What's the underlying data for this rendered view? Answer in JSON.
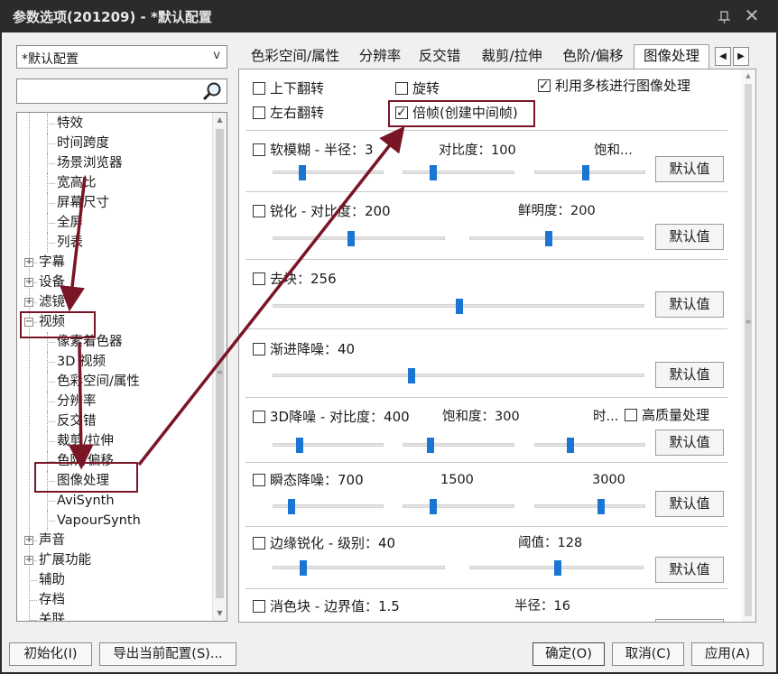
{
  "window": {
    "title": "参数选项(201209) - *默认配置"
  },
  "profile": {
    "selected": "*默认配置"
  },
  "search": {
    "placeholder": "",
    "value": ""
  },
  "tree": {
    "items": [
      {
        "label": "特效",
        "level": 2
      },
      {
        "label": "时间跨度",
        "level": 2
      },
      {
        "label": "场景浏览器",
        "level": 2
      },
      {
        "label": "宽高比",
        "level": 2
      },
      {
        "label": "屏幕尺寸",
        "level": 2
      },
      {
        "label": "全屏",
        "level": 2
      },
      {
        "label": "列表",
        "level": 2
      },
      {
        "label": "字幕",
        "level": 1,
        "expander": "+"
      },
      {
        "label": "设备",
        "level": 1,
        "expander": "+"
      },
      {
        "label": "滤镜",
        "level": 1,
        "expander": "+"
      },
      {
        "label": "视频",
        "level": 1,
        "expander": "−"
      },
      {
        "label": "像素着色器",
        "level": 2
      },
      {
        "label": "3D 视频",
        "level": 2
      },
      {
        "label": "色彩空间/属性",
        "level": 2
      },
      {
        "label": "分辨率",
        "level": 2
      },
      {
        "label": "反交错",
        "level": 2
      },
      {
        "label": "裁剪/拉伸",
        "level": 2
      },
      {
        "label": "色阶/偏移",
        "level": 2
      },
      {
        "label": "图像处理",
        "level": 2,
        "selected": true
      },
      {
        "label": "AviSynth",
        "level": 2
      },
      {
        "label": "VapourSynth",
        "level": 2
      },
      {
        "label": "声音",
        "level": 1,
        "expander": "+"
      },
      {
        "label": "扩展功能",
        "level": 1,
        "expander": "+"
      },
      {
        "label": "辅助",
        "level": 1
      },
      {
        "label": "存档",
        "level": 1
      },
      {
        "label": "关联",
        "level": 1
      }
    ]
  },
  "tabs": [
    "色彩空间/属性",
    "分辨率",
    "反交错",
    "裁剪/拉伸",
    "色阶/偏移",
    "图像处理"
  ],
  "active_tab": "图像处理",
  "options": {
    "flip_v": {
      "label": "上下翻转",
      "checked": false
    },
    "rotate": {
      "label": "旋转",
      "checked": false
    },
    "multicore": {
      "label": "利用多核进行图像处理",
      "checked": true
    },
    "flip_h": {
      "label": "左右翻转",
      "checked": false
    },
    "double_frame": {
      "label": "倍帧(创建中间帧)",
      "checked": true
    }
  },
  "groups": {
    "soft_blur": {
      "label": "软模糊 - 半径：3",
      "l2": "对比度：100",
      "l3": "饱和...",
      "levels": [
        0.24,
        0.25,
        0.45
      ]
    },
    "sharpen": {
      "label": "锐化 - 对比度：200",
      "l2": "鲜明度：200",
      "levels": [
        0.45,
        0.45
      ]
    },
    "deblock": {
      "label": "去块：256",
      "levels": [
        0.5
      ]
    },
    "progressive_denoise": {
      "label": "渐进降噪：40",
      "levels": [
        0.37
      ]
    },
    "denoise_3d": {
      "label": "3D降噪 - 对比度：400",
      "l2": "饱和度：300",
      "l3": "时...",
      "hq_label": "高质量处理",
      "hq_checked": false,
      "levels": [
        0.22,
        0.22,
        0.3
      ]
    },
    "transient_denoise": {
      "label": "瞬态降噪：700",
      "l2": "1500",
      "l3": "3000",
      "levels": [
        0.14,
        0.25,
        0.6
      ]
    },
    "edge_sharpen": {
      "label": "边缘锐化 - 级别：40",
      "l2": "阈值：128",
      "levels": [
        0.16,
        0.5
      ]
    },
    "chroma_deblock": {
      "label": "消色块 - 边界值：1.5",
      "l2": "半径：16"
    }
  },
  "default_button": "默认值",
  "buttons": {
    "init": "初始化(I)",
    "export": "导出当前配置(S)...",
    "ok": "确定(O)",
    "cancel": "取消(C)",
    "apply": "应用(A)"
  },
  "colors": {
    "accent": "#1a76d2",
    "annotation": "#7a1526",
    "titlebar": "#2b2b2b"
  }
}
